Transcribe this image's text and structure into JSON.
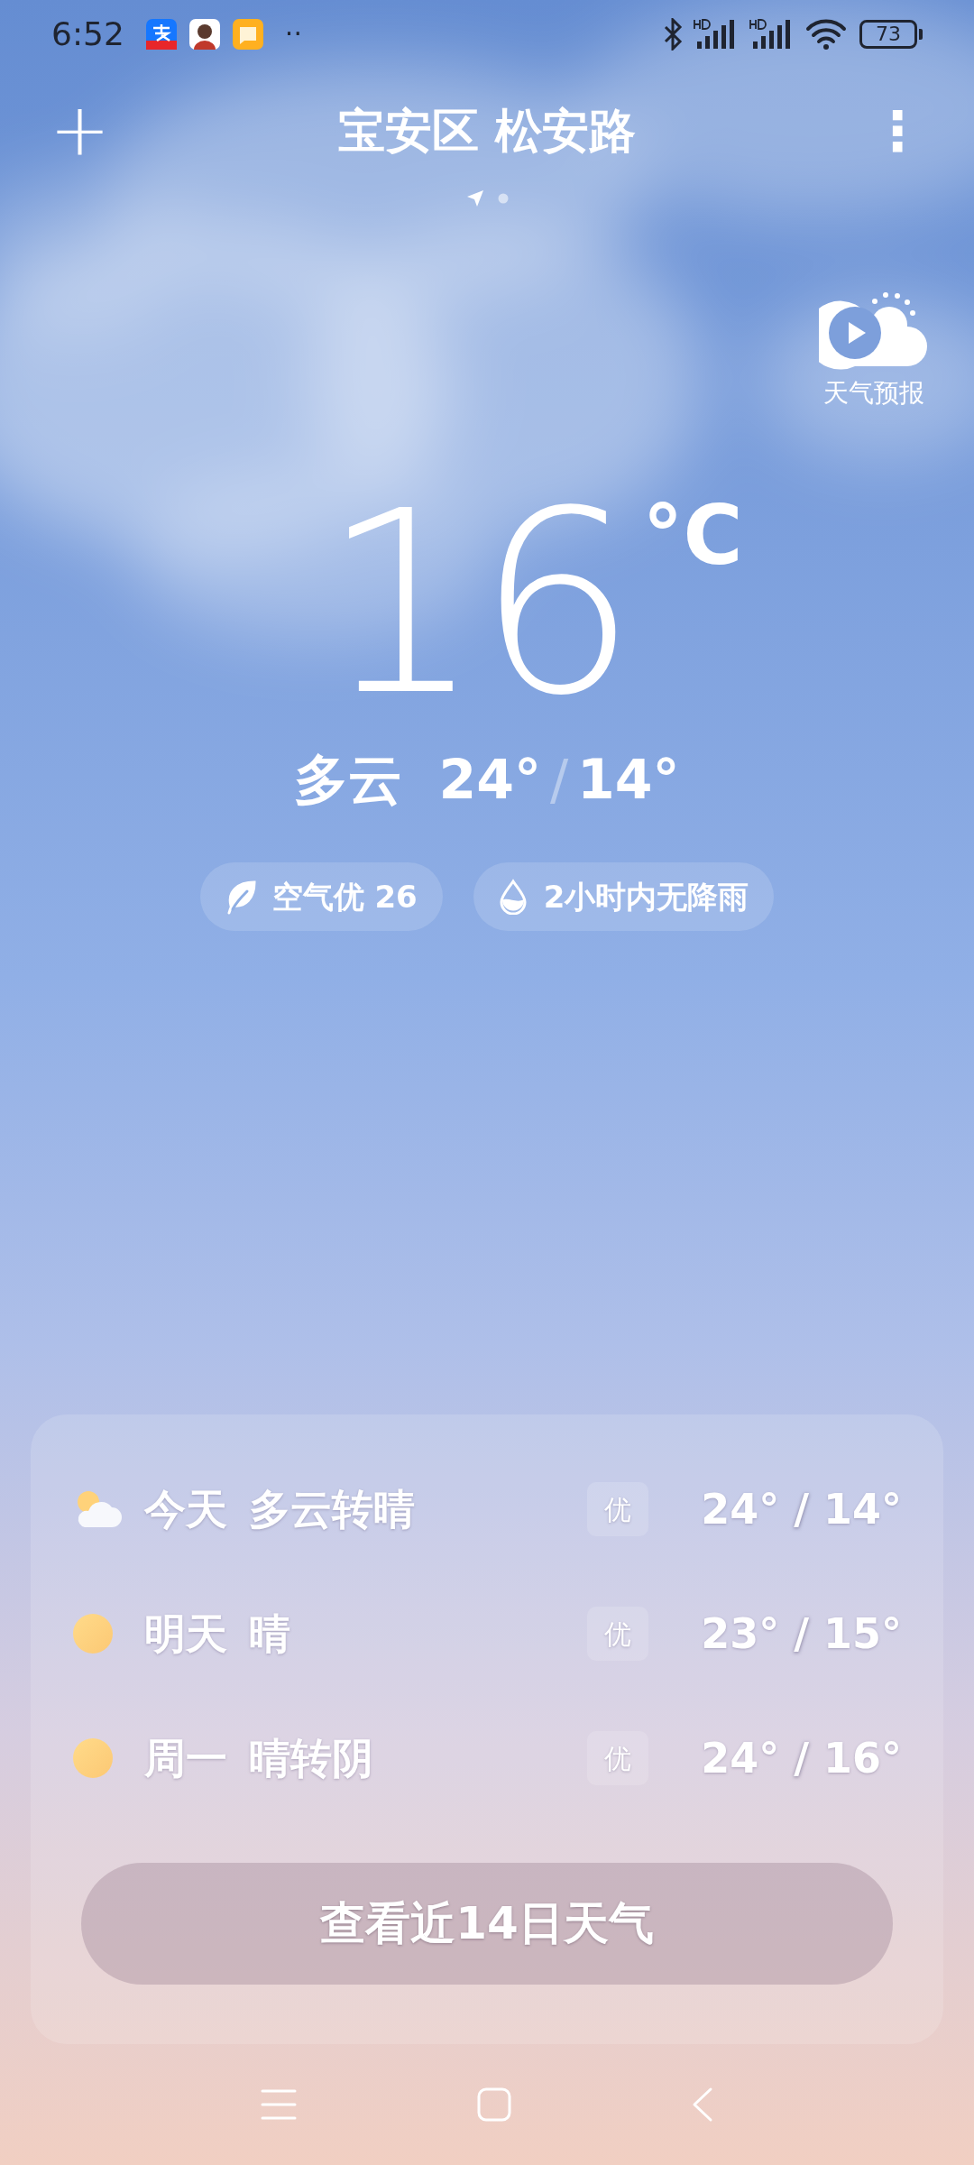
{
  "status_bar": {
    "time": "6:52",
    "notification_apps": [
      {
        "kind": "pay"
      },
      {
        "kind": "avatar"
      },
      {
        "kind": "note"
      }
    ],
    "more": "··",
    "battery": "73"
  },
  "header": {
    "add": "+",
    "location": "宝安区 松安路",
    "menu": "⋮"
  },
  "page_indicators": [
    {
      "kind": "location",
      "selected": true
    },
    {
      "kind": "dot",
      "selected": false
    }
  ],
  "forecast_video": {
    "label": "天气预报"
  },
  "current": {
    "temperature": "16",
    "unit": "°C",
    "condition": "多云",
    "high": "24°",
    "separator": "/",
    "low": "14°"
  },
  "chips": [
    {
      "kind": "leaf",
      "label": "空气优 26"
    },
    {
      "kind": "drop",
      "label": "2小时内无降雨"
    }
  ],
  "forecast": [
    {
      "kind": "cloudy_sun",
      "day": "今天",
      "condition": "多云转晴",
      "aqi": "优",
      "high": "24°",
      "separator": "/",
      "low": "14°"
    },
    {
      "kind": "sun",
      "day": "明天",
      "condition": "晴",
      "aqi": "优",
      "high": "23°",
      "separator": "/",
      "low": "15°"
    },
    {
      "kind": "sun",
      "day": "周一",
      "condition": "晴转阴",
      "aqi": "优",
      "high": "24°",
      "separator": "/",
      "low": "16°"
    }
  ],
  "more_button": "查看近14日天气"
}
